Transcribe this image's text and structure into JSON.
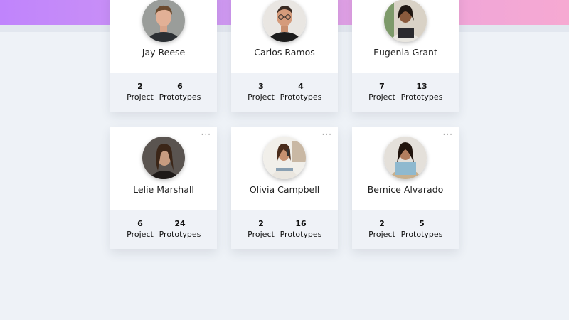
{
  "menu_glyph": "···",
  "labels": {
    "projects": "Project",
    "prototypes": "Prototypes"
  },
  "colors": {
    "banner_start": "#c084fc",
    "banner_end": "#f6a9d2",
    "background": "#eef2f7"
  },
  "users": [
    {
      "name": "Jay Reese",
      "projects": "2",
      "prototypes": "6",
      "avatar": "man-short-hair-dark-shirt"
    },
    {
      "name": "Carlos Ramos",
      "projects": "3",
      "prototypes": "4",
      "avatar": "man-glasses-black-shirt"
    },
    {
      "name": "Eugenia Grant",
      "projects": "7",
      "prototypes": "13",
      "avatar": "woman-laptop"
    },
    {
      "name": "Lelie Marshall",
      "projects": "6",
      "prototypes": "24",
      "avatar": "woman-dark-portrait"
    },
    {
      "name": "Olivia Campbell",
      "projects": "2",
      "prototypes": "16",
      "avatar": "woman-phone-desk"
    },
    {
      "name": "Bernice Alvarado",
      "projects": "2",
      "prototypes": "5",
      "avatar": "woman-laptop-smiling"
    }
  ]
}
